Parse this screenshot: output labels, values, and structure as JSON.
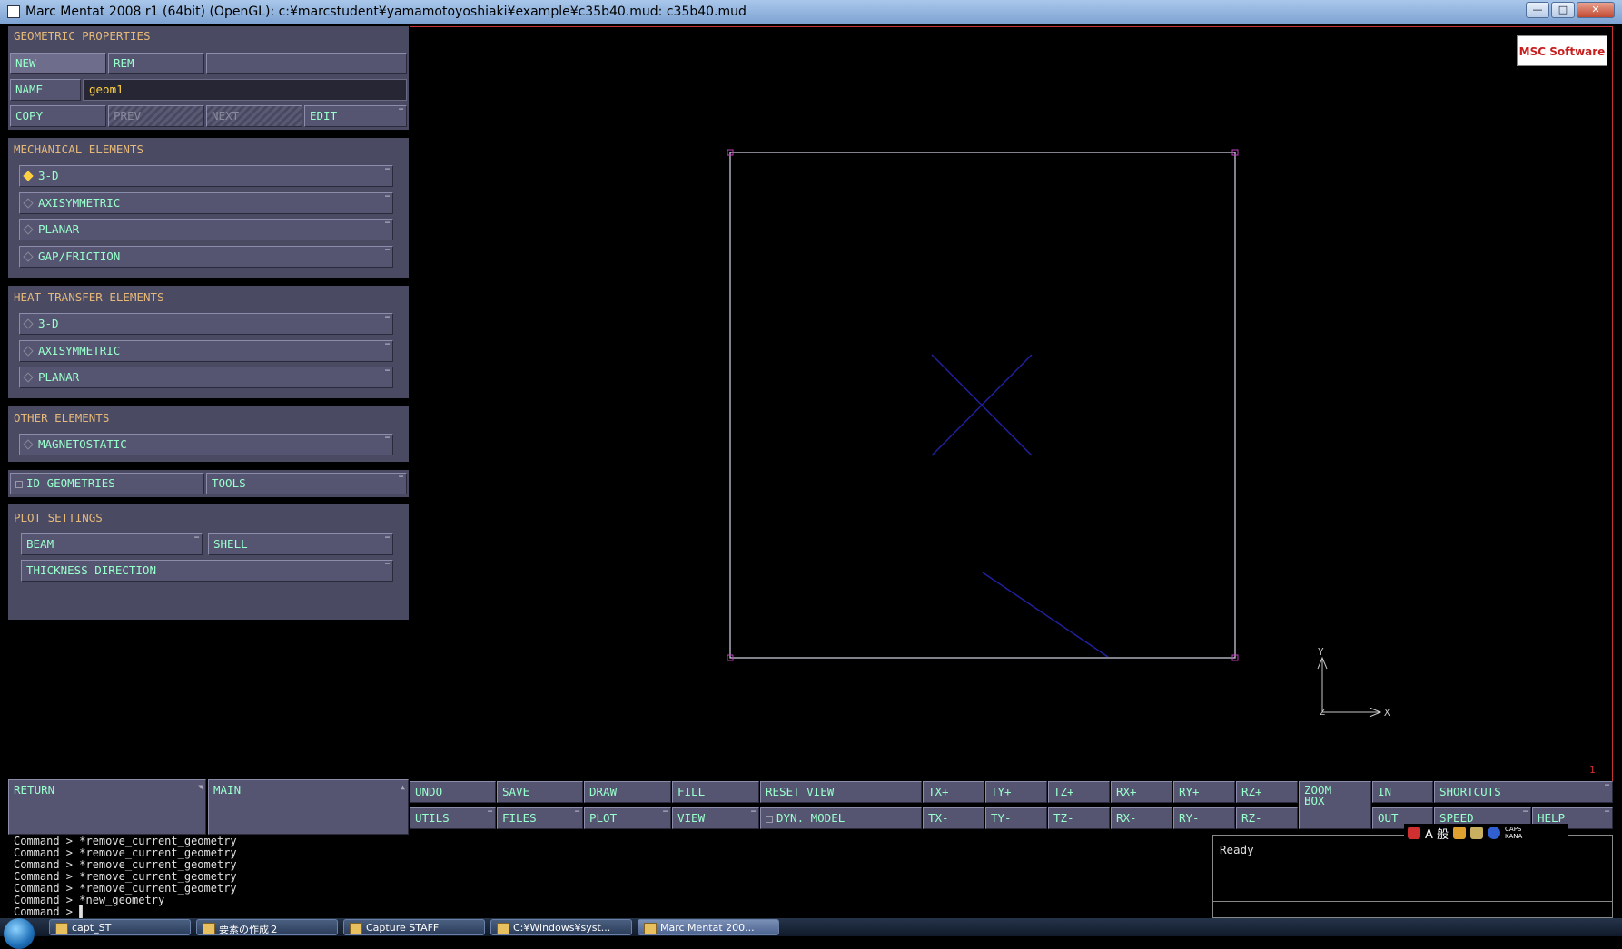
{
  "window": {
    "title": "Marc Mentat 2008 r1 (64bit) (OpenGL): c:¥marcstudent¥yamamotoyoshiaki¥example¥c35b40.mud: c35b40.mud",
    "min_label": "—",
    "max_label": "□",
    "close_label": "✕"
  },
  "panel": {
    "geometric_properties": {
      "heading": "GEOMETRIC PROPERTIES",
      "new": "NEW",
      "rem": "REM",
      "name_label": "NAME",
      "name_value": "geom1",
      "copy": "COPY",
      "prev": "PREV",
      "next": "NEXT",
      "edit": "EDIT"
    },
    "mechanical": {
      "heading": "MECHANICAL ELEMENTS",
      "items": [
        "3-D",
        "AXISYMMETRIC",
        "PLANAR",
        "GAP/FRICTION"
      ],
      "selected": "3-D"
    },
    "heat": {
      "heading": "HEAT TRANSFER ELEMENTS",
      "items": [
        "3-D",
        "AXISYMMETRIC",
        "PLANAR"
      ]
    },
    "other": {
      "heading": "OTHER ELEMENTS",
      "items": [
        "MAGNETOSTATIC"
      ]
    },
    "id_geometries": "ID GEOMETRIES",
    "tools": "TOOLS",
    "plot": {
      "heading": "PLOT SETTINGS",
      "beam": "BEAM",
      "shell": "SHELL",
      "thickness": "THICKNESS DIRECTION"
    },
    "return": "RETURN",
    "main": "MAIN"
  },
  "viewport": {
    "logo": "MSC Software",
    "axis_y": "Y",
    "axis_x": "X",
    "axis_z": "Z",
    "corner_id": "1",
    "colors": {
      "frame": "#c8c8d8",
      "element": "#2020a0",
      "handle": "#c040c0",
      "border": "#c83232"
    }
  },
  "toolbar": {
    "undo": "UNDO",
    "save": "SAVE",
    "draw": "DRAW",
    "fill": "FILL",
    "reset_view": "RESET VIEW",
    "txp": "TX+",
    "typ": "TY+",
    "tzp": "TZ+",
    "rxp": "RX+",
    "ryp": "RY+",
    "rzp": "RZ+",
    "zoom_box_1": "ZOOM",
    "zoom_box_2": "BOX",
    "in": "IN",
    "shortcuts": "SHORTCUTS",
    "utils": "UTILS",
    "files": "FILES",
    "plot": "PLOT",
    "view": "VIEW",
    "dyn_model": "DYN. MODEL",
    "txm": "TX-",
    "tym": "TY-",
    "tzm": "TZ-",
    "rxm": "RX-",
    "rym": "RY-",
    "rzm": "RZ-",
    "out": "OUT",
    "speed": "SPEED",
    "help": "HELP"
  },
  "command_log": [
    "Command > *remove_current_geometry",
    "Command > *remove_current_geometry",
    "Command > *remove_current_geometry",
    "Command > *remove_current_geometry",
    "Command > *remove_current_geometry",
    "Command > *new_geometry",
    "Command > ▌"
  ],
  "status": "Ready",
  "ime": {
    "mode": "A 般",
    "caps": "CAPS",
    "kana": "KANA"
  },
  "taskbar": {
    "items": [
      "capt_ST",
      "要素の作成２",
      "Capture STAFF",
      "C:¥Windows¥syst...",
      "Marc Mentat 200..."
    ]
  }
}
